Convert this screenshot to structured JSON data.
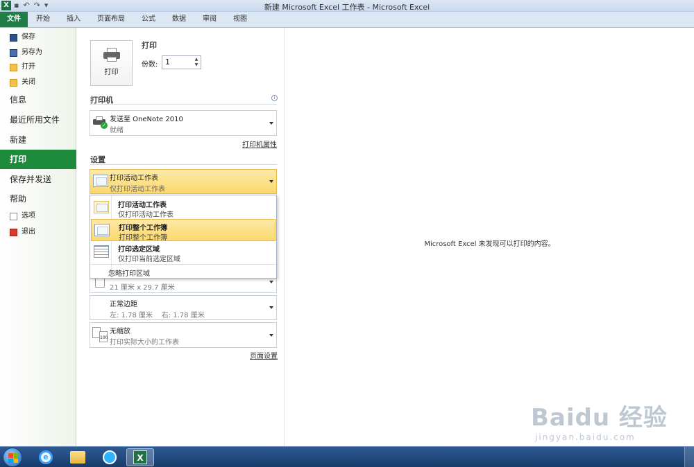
{
  "window": {
    "title": "新建 Microsoft Excel 工作表 - Microsoft Excel",
    "app_icon": "X"
  },
  "ribbon_tabs": [
    "文件",
    "开始",
    "插入",
    "页面布局",
    "公式",
    "数据",
    "审阅",
    "视图"
  ],
  "sidebar": {
    "save": "保存",
    "save_as": "另存为",
    "open": "打开",
    "close": "关闭",
    "info": "信息",
    "recent": "最近所用文件",
    "new": "新建",
    "print": "打印",
    "save_send": "保存并发送",
    "help": "帮助",
    "options": "选项",
    "exit": "退出"
  },
  "print_panel": {
    "print_button": "打印",
    "heading": "打印",
    "copies_label": "份数:",
    "copies_value": "1"
  },
  "printer": {
    "section_title": "打印机",
    "name": "发送至 OneNote 2010",
    "status": "就绪",
    "properties_link": "打印机属性"
  },
  "settings": {
    "section_title": "设置",
    "selected_main": "打印活动工作表",
    "selected_sub": "仅打印活动工作表",
    "options": [
      {
        "title": "打印活动工作表",
        "sub": "仅打印活动工作表"
      },
      {
        "title": "打印整个工作簿",
        "sub": "打印整个工作簿"
      },
      {
        "title": "打印选定区域",
        "sub": "仅打印当前选定区域"
      }
    ],
    "ignore_print_area": "忽略打印区域",
    "paper_sub": "21 厘米 x 29.7 厘米",
    "margins_main": "正常边距",
    "margins_sub": "左: 1.78 厘米    右: 1.78 厘米",
    "scaling_main": "无缩放",
    "scaling_sub": "打印实际大小的工作表",
    "scaling_icon_text": "100",
    "page_setup_link": "页面设置"
  },
  "preview": {
    "message": "Microsoft Excel 未发现可以打印的内容。"
  },
  "watermark": {
    "brand": "Baidu 经验",
    "url": "jingyan.baidu.com"
  },
  "colors": {
    "file_tab": "#1e7e45",
    "active_sidebar": "#1e8a3c",
    "highlight": "#fbd96c"
  }
}
